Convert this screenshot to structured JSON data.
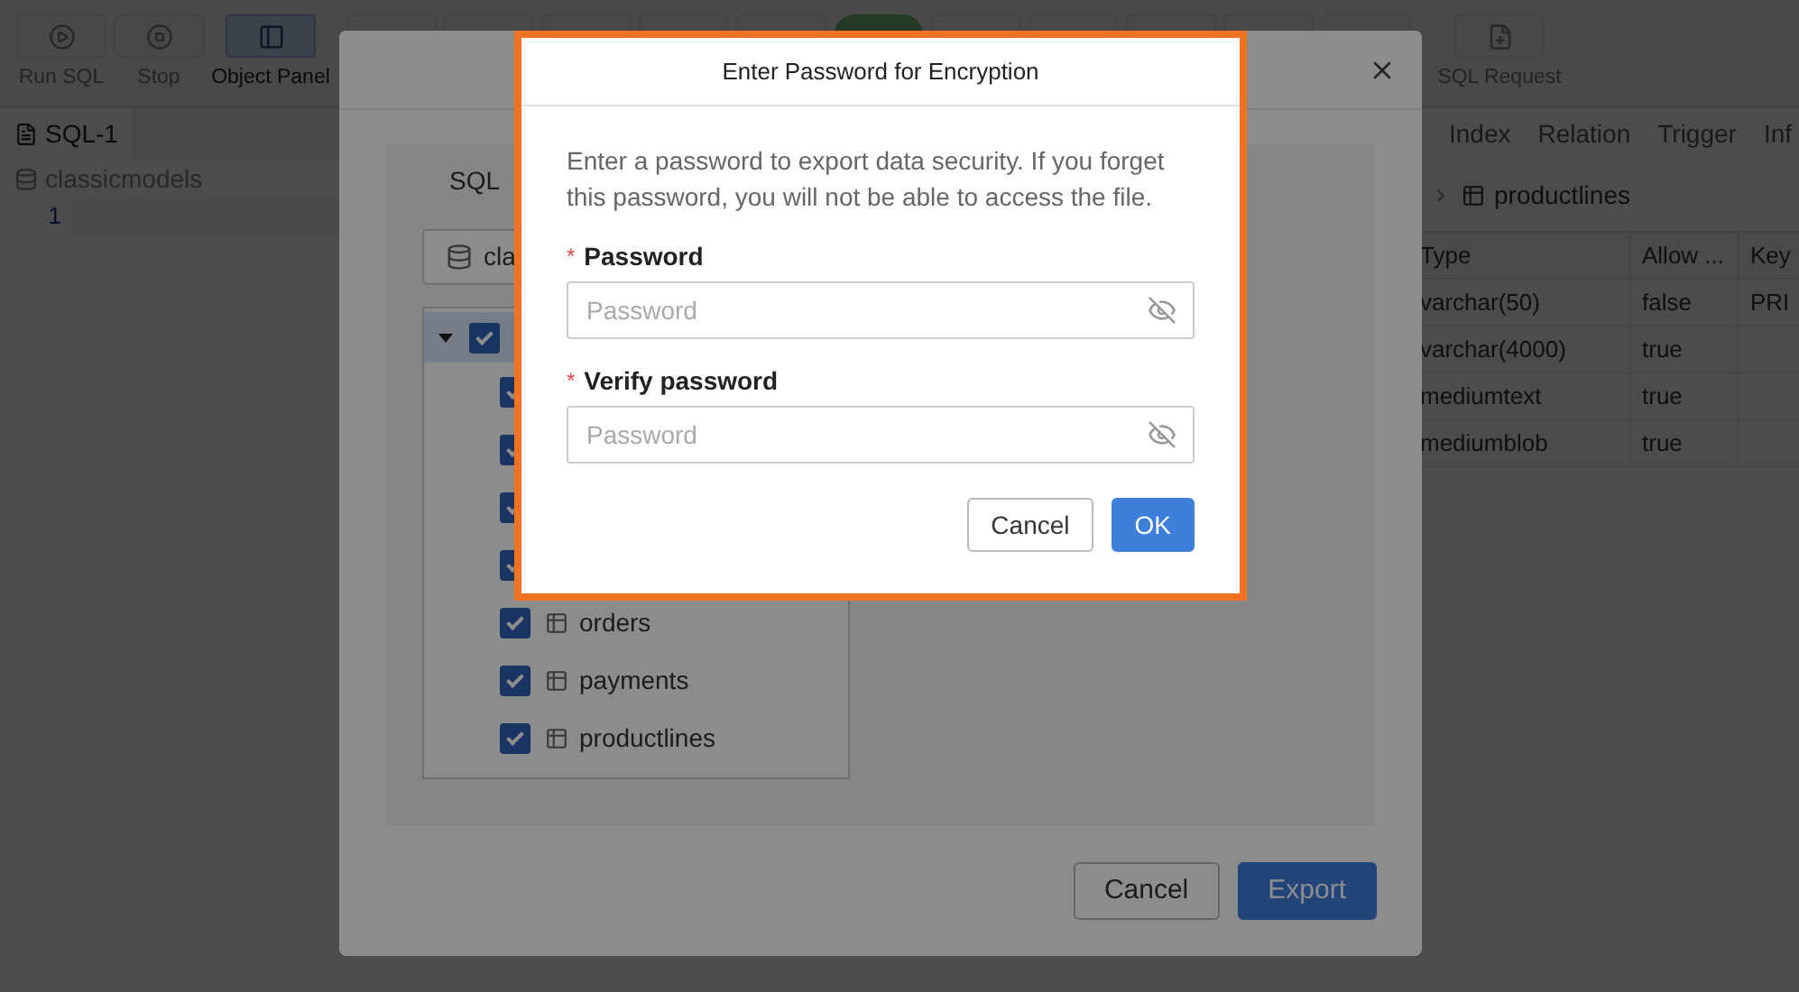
{
  "toolbar": {
    "buttons": [
      {
        "label": "Run SQL",
        "selected": false
      },
      {
        "label": "Stop",
        "selected": false
      },
      {
        "label": "Object Panel",
        "selected": true
      }
    ],
    "right_buttons": [
      {
        "label": "SQL Request"
      }
    ]
  },
  "editor": {
    "tab": "SQL-1",
    "database": "classicmodels",
    "line_numbers": [
      "1"
    ]
  },
  "object_panel": {
    "tabs": [
      {
        "label": "Index"
      },
      {
        "label": "Relation"
      },
      {
        "label": "Trigger"
      },
      {
        "label": "Inf"
      }
    ],
    "breadcrumb": "productlines",
    "table": {
      "columns": [
        "Type",
        "Allow ...",
        "Key"
      ],
      "rows": [
        {
          "cells": [
            "varchar(50)",
            "false",
            "PRI"
          ]
        },
        {
          "cells": [
            "varchar(4000)",
            "true"
          ]
        },
        {
          "cells": [
            "mediumtext",
            "true"
          ]
        },
        {
          "cells": [
            "mediumblob",
            "true"
          ]
        }
      ]
    }
  },
  "export_dialog": {
    "tab": "SQL",
    "database_select": "cla",
    "tree": {
      "expanded": true,
      "checked": true,
      "selected": true,
      "children": [
        {
          "checked": true
        },
        {
          "checked": true
        },
        {
          "checked": true
        },
        {
          "checked": true
        },
        {
          "label": "orders",
          "checked": true
        },
        {
          "label": "payments",
          "checked": true
        },
        {
          "label": "productlines",
          "checked": true
        }
      ]
    },
    "buttons": [
      {
        "label": "Cancel",
        "kind": "default"
      },
      {
        "label": "Export",
        "kind": "primary"
      }
    ]
  },
  "password_dialog": {
    "title": "Enter Password for Encryption",
    "message": "Enter a password to export data security. If you forget this password, you will not be able to access the file.",
    "fields": [
      {
        "label": "Password",
        "marker": "*",
        "placeholder": "Password"
      },
      {
        "label": "Verify password",
        "marker": "*",
        "placeholder": "Password"
      }
    ],
    "buttons": [
      {
        "label": "Cancel",
        "kind": "default"
      },
      {
        "label": "OK",
        "kind": "primary"
      }
    ]
  }
}
